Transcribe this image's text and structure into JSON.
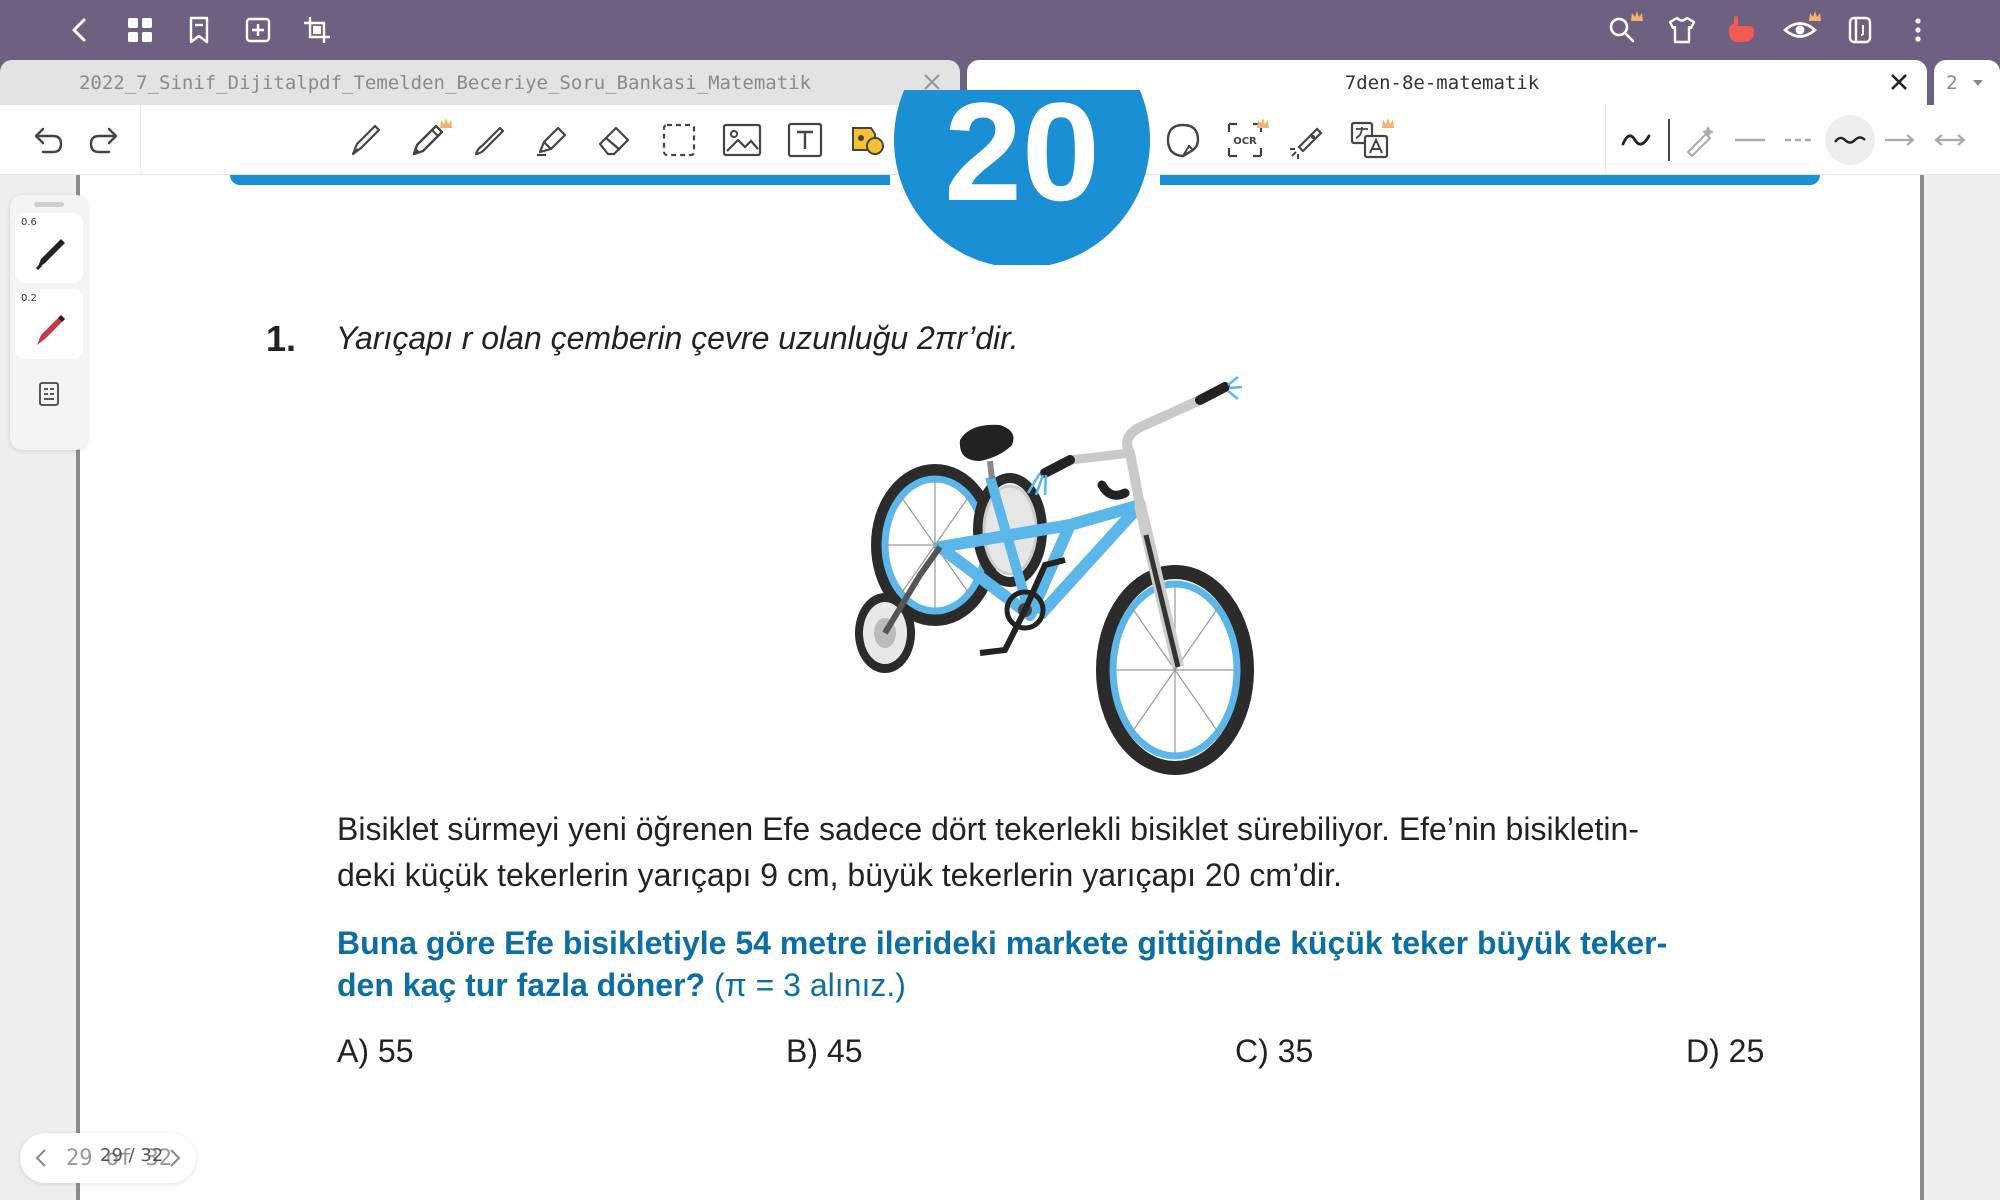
{
  "tabs": [
    {
      "label": "2022_7_Sinif_Dijitalpdf_Temelden_Beceriye_Soru_Bankasi_Matematik",
      "active": false
    },
    {
      "label": "7den-8e-matematik",
      "active": true
    }
  ],
  "tab_overflow_count": "2",
  "pen_panel": {
    "pen1_size": "0.6",
    "pen2_size": "0.2"
  },
  "page_nav": {
    "current": "29",
    "of_label": "of",
    "total": "32",
    "overlay": "29 / 32"
  },
  "document": {
    "banner_number": "20",
    "question_number": "1.",
    "premise": "Yarıçapı r olan çemberin çevre uzunluğu 2πr’dir.",
    "body_line1": "Bisiklet sürmeyi yeni öğrenen Efe sadece dört tekerlekli bisiklet sürebiliyor. Efe’nin bisikletin-",
    "body_line2": "deki küçük tekerlerin yarıçapı 9 cm, büyük tekerlerin yarıçapı 20 cm’dir.",
    "question_line1": "Buna göre Efe bisikletiyle 54 metre ilerideki markete gittiğinde küçük teker büyük teker-",
    "question_line2": "den kaç tur fazla döner?",
    "question_hint": "(π = 3 alınız.)",
    "options": [
      "A) 55",
      "B) 45",
      "C) 35",
      "D) 25"
    ]
  },
  "colors": {
    "topbar": "#6e6080",
    "accent_blue": "#1b8fd4",
    "question_blue": "#0b6fa4",
    "bike_frame": "#5bb6ea"
  },
  "icons": {
    "topbar_left": [
      "back-icon",
      "grid-icon",
      "bookmark-icon",
      "add-page-icon",
      "crop-icon"
    ],
    "topbar_right": [
      "search-icon",
      "shirt-icon",
      "hand-icon",
      "eye-icon",
      "notebook-icon",
      "more-icon"
    ],
    "tools": [
      "undo-icon",
      "redo-icon",
      "fountain-pen-icon",
      "pencil-icon",
      "brush-icon",
      "highlighter-icon",
      "eraser-icon",
      "lasso-icon",
      "image-icon",
      "text-box-icon",
      "sticker-icon",
      "tape-icon",
      "text-recognize-icon",
      "ai-icon",
      "microphone-icon",
      "shape-icon",
      "ocr-icon",
      "laser-icon",
      "translate-icon"
    ],
    "pen_styles": [
      "stroke-smooth-icon",
      "pen-tip-icon",
      "line-solid-icon",
      "line-dashed-icon",
      "line-wavy-icon",
      "arrow-icon",
      "double-arrow-icon"
    ]
  }
}
